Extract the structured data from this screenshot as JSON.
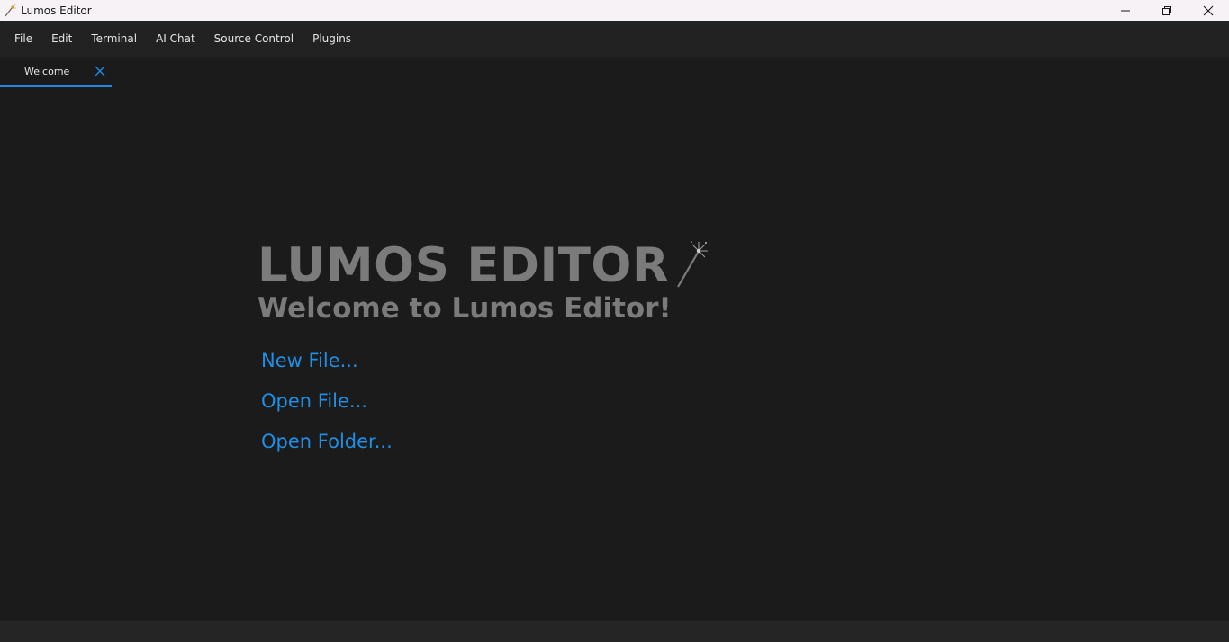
{
  "window": {
    "title": "Lumos Editor",
    "icons": {
      "app": "magic-wand-icon",
      "minimize": "minimize-icon",
      "maximize": "restore-icon",
      "close": "close-icon"
    }
  },
  "menu": {
    "items": [
      {
        "label": "File"
      },
      {
        "label": "Edit"
      },
      {
        "label": "Terminal"
      },
      {
        "label": "AI Chat"
      },
      {
        "label": "Source Control"
      },
      {
        "label": "Plugins"
      }
    ]
  },
  "tabs": [
    {
      "label": "Welcome",
      "active": true
    }
  ],
  "welcome": {
    "brand": "LUMOS EDITOR",
    "subtitle": "Welcome to Lumos Editor!",
    "actions": [
      {
        "label": "New File..."
      },
      {
        "label": "Open File..."
      },
      {
        "label": "Open Folder..."
      }
    ]
  },
  "colors": {
    "background": "#1b1b1b",
    "menubar": "#222222",
    "accent": "#1e88e5",
    "link": "#1e8fe6",
    "heading": "#7b7b7b"
  }
}
